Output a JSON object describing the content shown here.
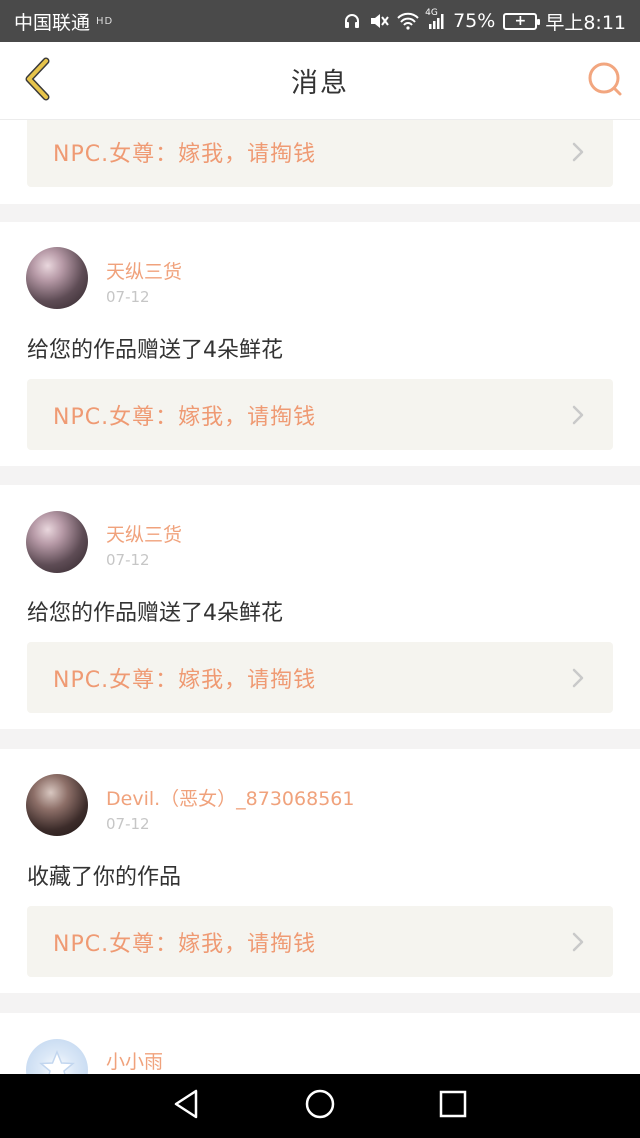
{
  "status": {
    "carrier": "中国联通",
    "carrier_suffix": "HD",
    "network": "4G",
    "battery_percent": "75%",
    "time": "早上8:11"
  },
  "header": {
    "title": "消息"
  },
  "npc_link_text": "NPC.女尊：嫁我，请掏钱",
  "cards": [
    {
      "name": "天纵三货",
      "date": "07-12",
      "message": "给您的作品赠送了4朵鲜花"
    },
    {
      "name": "天纵三货",
      "date": "07-12",
      "message": "给您的作品赠送了4朵鲜花"
    },
    {
      "name": "Devil.（恶女）_873068561",
      "date": "07-12",
      "message": "收藏了你的作品"
    },
    {
      "name": "小小雨"
    }
  ],
  "colors": {
    "accent": "#f0a27c",
    "back_icon": "#e7c44b",
    "status_bar": "#4a4a4a"
  },
  "icons": {
    "back": "back-chevron-icon",
    "search": "search-icon",
    "chevron": "chevron-right-icon"
  }
}
